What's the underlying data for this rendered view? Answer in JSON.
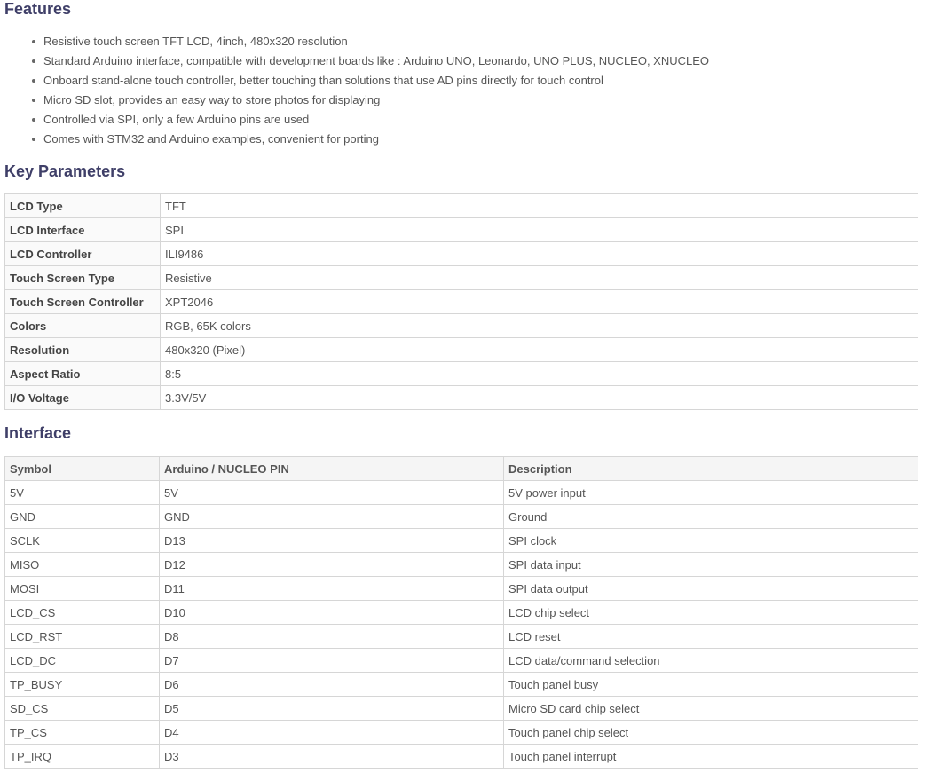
{
  "features": {
    "title": "Features",
    "items": [
      "Resistive touch screen TFT LCD, 4inch, 480x320 resolution",
      "Standard Arduino interface, compatible with development boards like : Arduino UNO, Leonardo, UNO PLUS, NUCLEO, XNUCLEO",
      "Onboard stand-alone touch controller, better touching than solutions that use AD pins directly for touch control",
      "Micro SD slot, provides an easy way to store photos for displaying",
      "Controlled via SPI, only a few Arduino pins are used",
      "Comes with STM32 and Arduino examples, convenient for porting"
    ]
  },
  "key_parameters": {
    "title": "Key Parameters",
    "rows": [
      {
        "key": "LCD Type",
        "value": "TFT"
      },
      {
        "key": "LCD Interface",
        "value": "SPI"
      },
      {
        "key": "LCD Controller",
        "value": "ILI9486"
      },
      {
        "key": "Touch Screen Type",
        "value": "Resistive"
      },
      {
        "key": "Touch Screen Controller",
        "value": "XPT2046"
      },
      {
        "key": "Colors",
        "value": "RGB, 65K colors"
      },
      {
        "key": "Resolution",
        "value": "480x320 (Pixel)"
      },
      {
        "key": "Aspect Ratio",
        "value": "8:5"
      },
      {
        "key": "I/O Voltage",
        "value": "3.3V/5V"
      }
    ]
  },
  "interface": {
    "title": "Interface",
    "headers": [
      "Symbol",
      "Arduino / NUCLEO PIN",
      "Description"
    ],
    "rows": [
      [
        "5V",
        "5V",
        "5V power input"
      ],
      [
        "GND",
        "GND",
        "Ground"
      ],
      [
        "SCLK",
        "D13",
        "SPI clock"
      ],
      [
        "MISO",
        "D12",
        "SPI data input"
      ],
      [
        "MOSI",
        "D11",
        "SPI data output"
      ],
      [
        "LCD_CS",
        "D10",
        "LCD chip select"
      ],
      [
        "LCD_RST",
        "D8",
        "LCD reset"
      ],
      [
        "LCD_DC",
        "D7",
        "LCD data/command selection"
      ],
      [
        "TP_BUSY",
        "D6",
        "Touch panel busy"
      ],
      [
        "SD_CS",
        "D5",
        "Micro SD card chip select"
      ],
      [
        "TP_CS",
        "D4",
        "Touch panel chip select"
      ],
      [
        "TP_IRQ",
        "D3",
        "Touch panel interrupt"
      ]
    ]
  }
}
